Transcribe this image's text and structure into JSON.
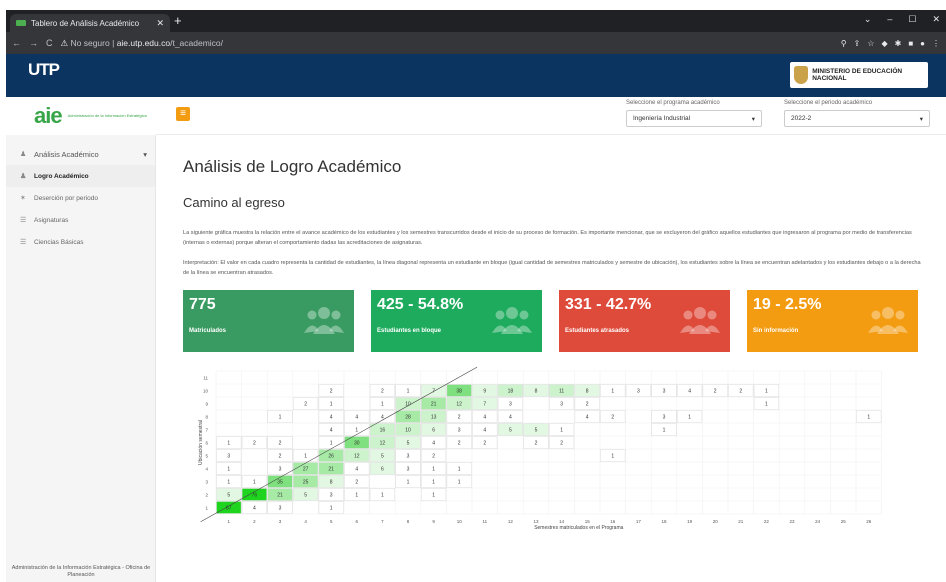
{
  "browser": {
    "tab_title": "Tablero de Análisis Académico",
    "new_tab": "+",
    "security": "No seguro",
    "url_host": "aie.utp.edu.co",
    "url_path": "/t_academico/"
  },
  "top": {
    "utp_logo": "UTP",
    "ministerio": "MINISTERIO DE EDUCACIÓN NACIONAL"
  },
  "header": {
    "aie_logo": "aie",
    "aie_sub": "Administración de la Información Estratégica",
    "program_label": "Seleccione el programa académico",
    "program_value": "Ingeniería Industrial",
    "period_label": "Seleccione el periodo académico",
    "period_value": "2022-2"
  },
  "sidebar": {
    "items": [
      {
        "label": "Análisis Académico"
      },
      {
        "label": "Logro Académico"
      },
      {
        "label": "Deserción por periodo"
      },
      {
        "label": "Asignaturas"
      },
      {
        "label": "Ciencias Básicas"
      }
    ],
    "footer": "Administración de la Información Estratégica - Oficina de Planeación"
  },
  "main": {
    "title": "Análisis de Logro Académico",
    "subtitle": "Camino al egreso",
    "p1": "La siguiente gráfica muestra la relación entre el avance académico de los estudiantes y los semestres transcurridos desde el inicio de su proceso de formación. Es importante mencionar, que se excluyeron del gráfico aquellos estudiantes que ingresaron al programa por medio de transferencias (internas o externas) porque alteran el comportamiento dadas las acreditaciones de asignaturas.",
    "p2": "Interpretación: El valor en cada cuadro representa la cantidad de estudiantes, la línea diagonal representa un estudiante en bloque (igual cantidad de semestres matriculados y semestre de ubicación), los estudiantes sobre la línea se encuentran adelantados y los estudiantes debajo o a la derecha de la línea se encuentran atrasados.",
    "cards": [
      {
        "value": "775",
        "label": "Matriculados",
        "color": "#3a9b62"
      },
      {
        "value": "425 - 54.8%",
        "label": "Estudiantes en bloque",
        "color": "#1fab5e"
      },
      {
        "value": "331 - 42.7%",
        "label": "Estudiantes atrasados",
        "color": "#de4b3b"
      },
      {
        "value": "19 - 2.5%",
        "label": "Sin información",
        "color": "#f39c12"
      }
    ]
  },
  "chart_data": {
    "type": "heatmap",
    "xlabel": "Semestres matriculados en el Programa",
    "ylabel": "Ubicación semestral",
    "x": [
      1,
      2,
      3,
      4,
      5,
      6,
      7,
      8,
      9,
      10,
      11,
      12,
      13,
      14,
      15,
      16,
      17,
      18,
      19,
      20,
      21,
      22,
      23,
      24,
      25,
      26
    ],
    "y": [
      1,
      2,
      3,
      4,
      5,
      6,
      7,
      8,
      9,
      10,
      11
    ],
    "cells": [
      [
        1,
        1,
        87
      ],
      [
        2,
        1,
        4
      ],
      [
        3,
        1,
        3
      ],
      [
        5,
        1,
        1
      ],
      [
        1,
        2,
        5
      ],
      [
        2,
        2,
        76
      ],
      [
        3,
        2,
        21
      ],
      [
        4,
        2,
        5
      ],
      [
        5,
        2,
        3
      ],
      [
        6,
        2,
        1
      ],
      [
        7,
        2,
        1
      ],
      [
        9,
        2,
        1
      ],
      [
        1,
        3,
        1
      ],
      [
        2,
        3,
        1
      ],
      [
        3,
        3,
        35
      ],
      [
        4,
        3,
        25
      ],
      [
        5,
        3,
        8
      ],
      [
        6,
        3,
        2
      ],
      [
        8,
        3,
        1
      ],
      [
        9,
        3,
        1
      ],
      [
        10,
        3,
        1
      ],
      [
        1,
        4,
        1
      ],
      [
        3,
        4,
        3
      ],
      [
        4,
        4,
        27
      ],
      [
        5,
        4,
        21
      ],
      [
        6,
        4,
        4
      ],
      [
        7,
        4,
        6
      ],
      [
        8,
        4,
        3
      ],
      [
        9,
        4,
        1
      ],
      [
        10,
        4,
        1
      ],
      [
        1,
        5,
        3
      ],
      [
        3,
        5,
        2
      ],
      [
        4,
        5,
        1
      ],
      [
        5,
        5,
        26
      ],
      [
        6,
        5,
        12
      ],
      [
        7,
        5,
        5
      ],
      [
        8,
        5,
        3
      ],
      [
        9,
        5,
        2
      ],
      [
        16,
        5,
        1
      ],
      [
        1,
        6,
        1
      ],
      [
        2,
        6,
        2
      ],
      [
        3,
        6,
        2
      ],
      [
        5,
        6,
        1
      ],
      [
        6,
        6,
        30
      ],
      [
        7,
        6,
        12
      ],
      [
        8,
        6,
        5
      ],
      [
        9,
        6,
        4
      ],
      [
        10,
        6,
        2
      ],
      [
        11,
        6,
        2
      ],
      [
        13,
        6,
        2
      ],
      [
        14,
        6,
        2
      ],
      [
        5,
        7,
        4
      ],
      [
        6,
        7,
        1
      ],
      [
        7,
        7,
        16
      ],
      [
        8,
        7,
        10
      ],
      [
        9,
        7,
        6
      ],
      [
        10,
        7,
        3
      ],
      [
        11,
        7,
        4
      ],
      [
        12,
        7,
        5
      ],
      [
        13,
        7,
        5
      ],
      [
        14,
        7,
        1
      ],
      [
        18,
        7,
        1
      ],
      [
        3,
        8,
        1
      ],
      [
        5,
        8,
        4
      ],
      [
        6,
        8,
        4
      ],
      [
        7,
        8,
        4
      ],
      [
        8,
        8,
        28
      ],
      [
        9,
        8,
        13
      ],
      [
        10,
        8,
        2
      ],
      [
        11,
        8,
        4
      ],
      [
        12,
        8,
        4
      ],
      [
        15,
        8,
        4
      ],
      [
        16,
        8,
        2
      ],
      [
        18,
        8,
        3
      ],
      [
        19,
        8,
        1
      ],
      [
        26,
        8,
        1
      ],
      [
        4,
        9,
        2
      ],
      [
        5,
        9,
        1
      ],
      [
        7,
        9,
        1
      ],
      [
        8,
        9,
        10
      ],
      [
        9,
        9,
        21
      ],
      [
        10,
        9,
        12
      ],
      [
        11,
        9,
        7
      ],
      [
        12,
        9,
        3
      ],
      [
        14,
        9,
        3
      ],
      [
        15,
        9,
        2
      ],
      [
        22,
        9,
        1
      ],
      [
        5,
        10,
        2
      ],
      [
        7,
        10,
        2
      ],
      [
        8,
        10,
        1
      ],
      [
        9,
        10,
        7
      ],
      [
        10,
        10,
        38
      ],
      [
        11,
        10,
        9
      ],
      [
        12,
        10,
        18
      ],
      [
        13,
        10,
        8
      ],
      [
        14,
        10,
        11
      ],
      [
        15,
        10,
        8
      ],
      [
        16,
        10,
        1
      ],
      [
        17,
        10,
        3
      ],
      [
        18,
        10,
        3
      ],
      [
        19,
        10,
        4
      ],
      [
        20,
        10,
        2
      ],
      [
        21,
        10,
        2
      ],
      [
        22,
        10,
        1
      ]
    ]
  }
}
